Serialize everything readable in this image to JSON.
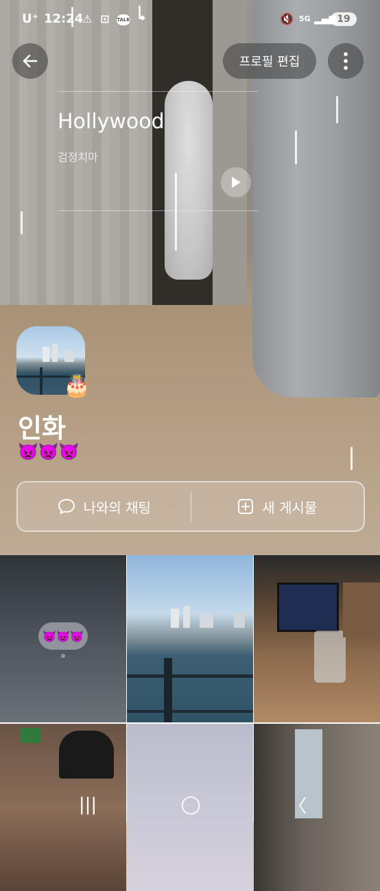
{
  "status_bar": {
    "carrier": "U⁺",
    "time": "12:24",
    "network": "5G",
    "battery": "19"
  },
  "header": {
    "back_icon": "arrow-left-icon",
    "edit_profile_label": "프로필 편집",
    "more_icon": "more-vertical-icon"
  },
  "music": {
    "title": "Hollywood",
    "artist": "검정치마",
    "play_icon": "play-icon"
  },
  "profile": {
    "name": "인화",
    "status_emoji": "👿👿👿",
    "birthday_icon": "🎂"
  },
  "actions": {
    "chat_label": "나와의 채팅",
    "new_post_label": "새 게시물"
  },
  "feed": {
    "tile1_bubble": "👿👿👿"
  },
  "nav_bar": {
    "recent": "|||",
    "home": "◯",
    "back": "〈"
  },
  "colors": {
    "overlay_button": "#3c3c3c",
    "text": "#ffffff"
  }
}
